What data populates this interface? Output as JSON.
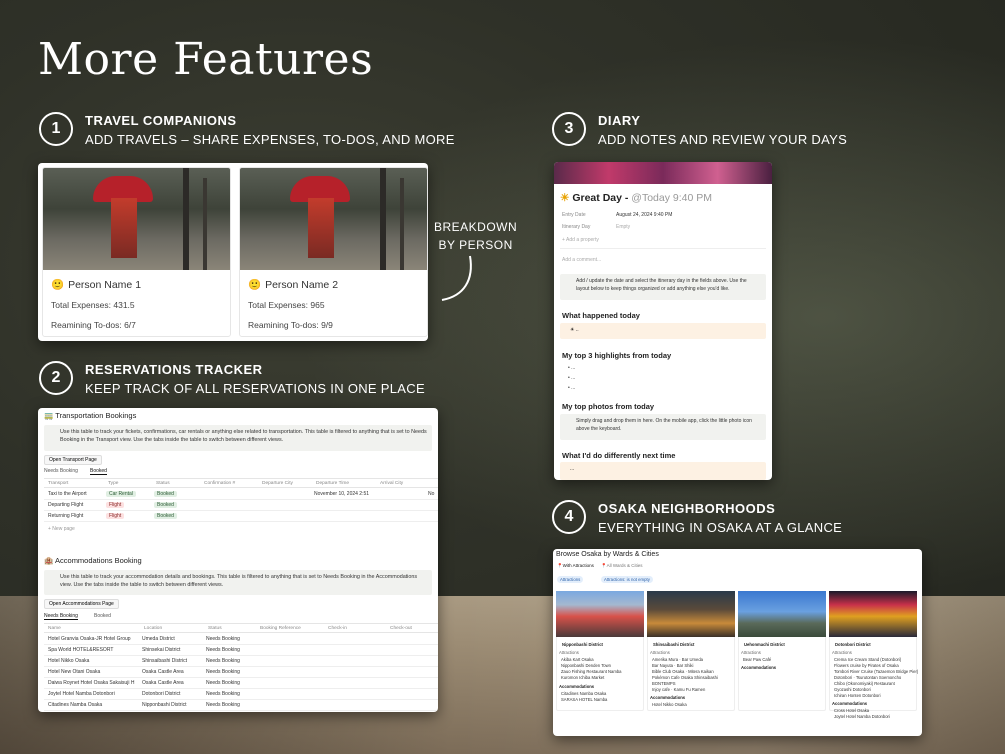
{
  "page": {
    "title": "More Features"
  },
  "sections": {
    "s1": {
      "num": "1",
      "head": "TRAVEL COMPANIONS",
      "sub": "ADD TRAVELS – SHARE EXPENSES, TO-DOS, AND MORE"
    },
    "s2": {
      "num": "2",
      "head": "RESERVATIONS TRACKER",
      "sub": "KEEP TRACK OF ALL RESERVATIONS IN ONE PLACE"
    },
    "s3": {
      "num": "3",
      "head": "DIARY",
      "sub": "ADD NOTES AND REVIEW YOUR DAYS"
    },
    "s4": {
      "num": "4",
      "head": "OSAKA NEIGHBORHOODS",
      "sub": "EVERYTHING IN OSAKA AT A GLANCE"
    }
  },
  "breakdown": {
    "line1": "BREAKDOWN",
    "line2": "BY PERSON"
  },
  "companions": [
    {
      "name": "Person Name 1",
      "expenses": "Total Expenses: 431.5",
      "todos": "Reamining To-dos: 6/7"
    },
    {
      "name": "Person Name 2",
      "expenses": "Total Expenses: 965",
      "todos": "Reamining To-dos: 9/9"
    }
  ],
  "transport": {
    "title": "Transportation Bookings",
    "note": "Use this table to track your fickets, confirmations, car rentals or anything else related to transportation. This table is filtered to anything that is set to Needs Booking in the Transport view. Use the tabs inside the table to switch between different views.",
    "open_page": "Open Transport Page",
    "tabs": [
      "Needs Booking",
      "Booked"
    ],
    "columns": [
      "Transport",
      "Type",
      "Status",
      "Confirmation #",
      "Departure City",
      "Departure Time",
      "Arrival City"
    ],
    "rows": [
      {
        "name": "Taxi to the Airport",
        "type": "Car Rental",
        "status": "Booked",
        "time": "November 10, 2024 2:51",
        "extra": "No"
      },
      {
        "name": "Departing Flight",
        "type": "Flight",
        "status": "Booked",
        "time": "",
        "extra": ""
      },
      {
        "name": "Returning Flight",
        "type": "Flight",
        "status": "Booked",
        "time": "",
        "extra": ""
      }
    ],
    "new_page": "+ New page"
  },
  "accommodations": {
    "title": "Accommodations Booking",
    "note": "Use this table to track your accommodation details and bookings. This table is filtered to anything that is set to Needs Booking in the Accommodations view. Use the tabs inside the table to switch between different views.",
    "open_page": "Open Accommodations Page",
    "tabs": [
      "Needs Booking",
      "Booked"
    ],
    "columns": [
      "Name",
      "Location",
      "Status",
      "Booking Reference",
      "Check-in",
      "Check-out"
    ],
    "rows": [
      {
        "name": "Hotel Granvia Osaka-JR Hotel Group",
        "loc": "Umeda District",
        "status": "Needs Booking"
      },
      {
        "name": "Spa World HOTEL&RESORT",
        "loc": "Shinsekai District",
        "status": "Needs Booking"
      },
      {
        "name": "Hotel Nikko Osaka",
        "loc": "Shinsaibashi District",
        "status": "Needs Booking"
      },
      {
        "name": "Hotel New Otani Osaka",
        "loc": "Osaka Castle Area",
        "status": "Needs Booking"
      },
      {
        "name": "Daiwa Roynet Hotel Osaka Sakaisuji H",
        "loc": "Osaka Castle Area",
        "status": "Needs Booking"
      },
      {
        "name": "Joytel Hotel Namba Dotonbori",
        "loc": "Dotonbori District",
        "status": "Needs Booking"
      },
      {
        "name": "Citadines Namba Osaka",
        "loc": "Nipponbashi District",
        "status": "Needs Booking"
      }
    ]
  },
  "diary": {
    "title": "Great Day -",
    "date_mention": "@Today 9:40 PM",
    "props": [
      {
        "label": "Entry Date",
        "value": "August 24, 2024 9:40 PM"
      },
      {
        "label": "Itinerary Day",
        "value": "Empty"
      }
    ],
    "add_property": "+ Add a property",
    "add_comment": "Add a comment...",
    "callout": "Add / update the date and select the itinerary day in the fields above. Use the layout below to keep things organized or add anything else you'd like.",
    "h1": "What happened today",
    "h2": "My top 3 highlights from today",
    "bullets": [
      "...",
      "...",
      "..."
    ],
    "h3": "My top photos from today",
    "photo_note": "Simply drag and drop them in here. On the mobile app, click the little photo icon above the keyboard.",
    "h4": "What I'd do differently next time",
    "ellipsis": "..."
  },
  "osaka": {
    "title": "Browse Osaka by Wards & Cities",
    "tabs": [
      "With Attractions",
      "All Wards & Cities"
    ],
    "filters": [
      "Attractions",
      "Attractions: is not empty"
    ],
    "districts": [
      {
        "name": "Nipponbashi District",
        "attractions": [
          "Akiba Kart Osaka",
          "Nipponbashi Denden Town",
          "Zauo Fishing Restaurant Namba",
          "Kuromon Ichiba Market"
        ],
        "acc_label": "Accommodations",
        "acc": [
          "Citadines Namba Osaka",
          "SARASA HOTEL Namba"
        ]
      },
      {
        "name": "Shinsaibashi District",
        "attractions": [
          "Amerika Mura",
          "Bar Umeda",
          "Bar Nayuta",
          "Bar Shiki",
          "Bible Club Osaka",
          "Mitera Kaikan",
          "Pokémon Cafe Osaka Shinsaibashi",
          "BONTEMPS",
          "Injoy cafe",
          "Kamu Fu Ramen"
        ],
        "acc_label": "Accommodations",
        "acc": [
          "Hotel Nikko Osaka"
        ]
      },
      {
        "name": "Uehonmachi District",
        "attractions": [
          "Bear Paw Café"
        ],
        "acc_label": "Accommodations",
        "acc": []
      },
      {
        "name": "Dotonbori District",
        "attractions": [
          "Crema Ice Cream Stand (Dotonbori)",
          "Flowers cruise by Pirates of Osaka",
          "Tombori River Cruise (Tazaemon Bridge Pier)",
          "Dotonbori",
          "Tsurutontan Soemoncho",
          "Chibo (Okonomiyaki) Restaurant",
          "Gyozashi Dotonbori",
          "Ichiran Honten Dotonbori"
        ],
        "acc_label": "Accommodations",
        "acc": [
          "Cross Hotel Osaka",
          "Joytel Hotel Namba Dotonbori"
        ]
      }
    ]
  }
}
